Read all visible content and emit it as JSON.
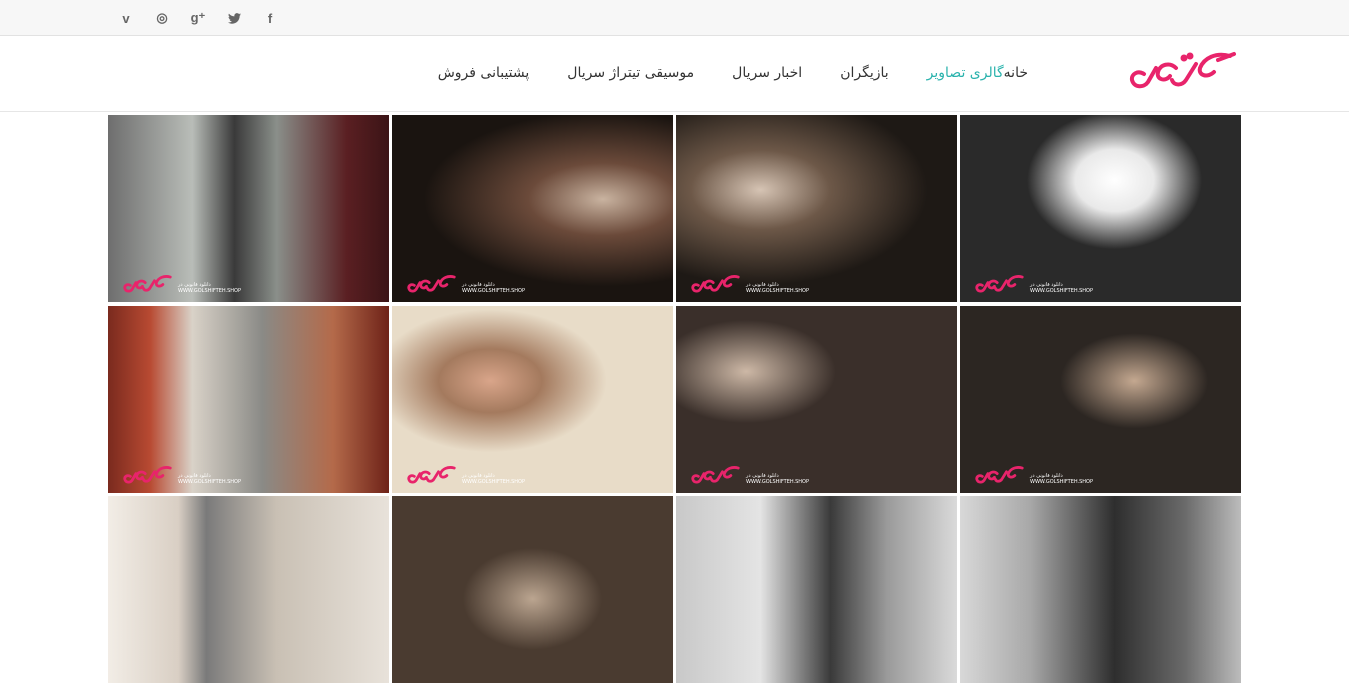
{
  "social": [
    {
      "name": "vimeo-icon",
      "glyph": "v"
    },
    {
      "name": "dribbble-icon",
      "glyph": "◎"
    },
    {
      "name": "google-plus-icon",
      "glyph": "g⁺"
    },
    {
      "name": "twitter-icon",
      "glyph": "🐦"
    },
    {
      "name": "facebook-icon",
      "glyph": "f"
    }
  ],
  "brand": {
    "logo_color": "#e8246b",
    "accent": "#2bb3ad"
  },
  "nav": {
    "home": "خانه",
    "gallery": "گالری تصاویر",
    "actors": "بازیگران",
    "news": "اخبار سریال",
    "music": "موسیقی تیتراژ سریال",
    "support": "پشتیبانی فروش"
  },
  "watermark": {
    "line1": "دانلود قانونی در",
    "line2": "WWW.GOLSHIFTEH.SHOP"
  },
  "gallery": [
    {
      "label": "photo-1"
    },
    {
      "label": "photo-2"
    },
    {
      "label": "photo-3"
    },
    {
      "label": "photo-4"
    },
    {
      "label": "photo-5"
    },
    {
      "label": "photo-6"
    },
    {
      "label": "photo-7"
    },
    {
      "label": "photo-8"
    },
    {
      "label": "photo-9"
    },
    {
      "label": "photo-10"
    },
    {
      "label": "photo-11"
    },
    {
      "label": "photo-12"
    }
  ]
}
